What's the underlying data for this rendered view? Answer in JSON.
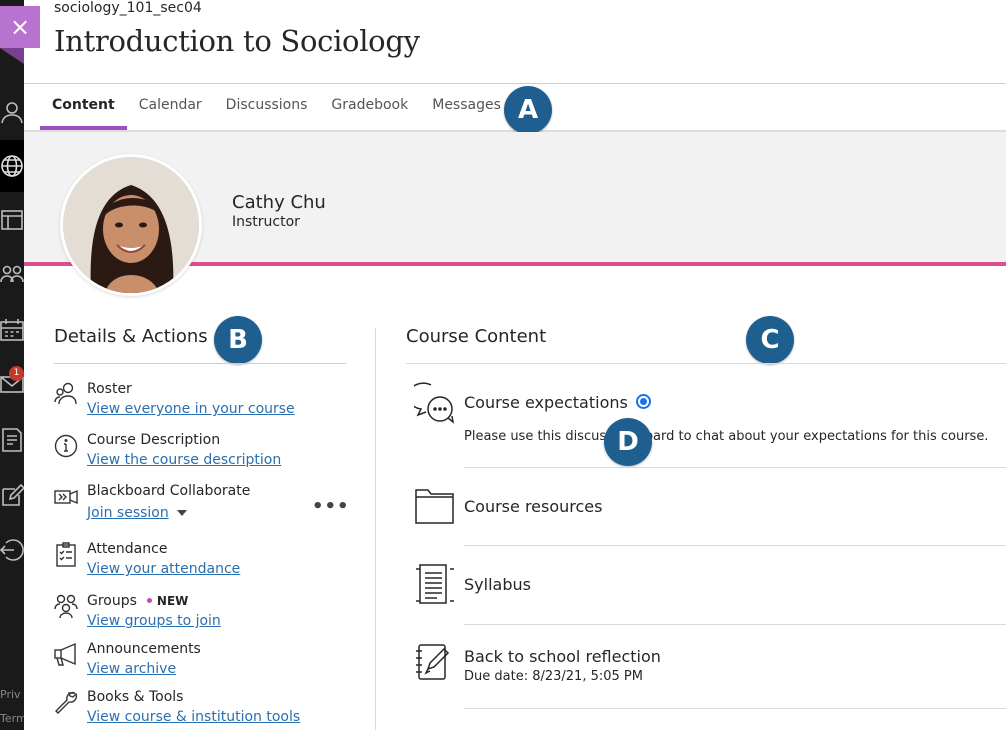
{
  "header": {
    "course_id": "sociology_101_sec04",
    "course_title": "Introduction to Sociology",
    "close_label": "×"
  },
  "tabs": [
    {
      "label": "Content",
      "active": true
    },
    {
      "label": "Calendar"
    },
    {
      "label": "Discussions"
    },
    {
      "label": "Gradebook"
    },
    {
      "label": "Messages"
    }
  ],
  "callouts": [
    "A",
    "B",
    "C",
    "D"
  ],
  "rail": {
    "mail_badge": "1",
    "footer": [
      "Priv",
      "Term"
    ]
  },
  "instructor": {
    "name": "Cathy Chu",
    "role": "Instructor"
  },
  "details": {
    "title": "Details & Actions",
    "items": [
      {
        "icon": "roster-icon",
        "title": "Roster",
        "link": "View everyone in your course"
      },
      {
        "icon": "info-icon",
        "title": "Course Description",
        "link": "View the course description"
      },
      {
        "icon": "collaborate-icon",
        "title": "Blackboard Collaborate",
        "link": "Join session"
      },
      {
        "icon": "attendance-icon",
        "title": "Attendance",
        "link": "View your attendance"
      },
      {
        "icon": "groups-icon",
        "title": "Groups",
        "badge": "NEW",
        "link": "View groups to join"
      },
      {
        "icon": "megaphone-icon",
        "title": "Announcements",
        "link": "View archive"
      },
      {
        "icon": "wrench-icon",
        "title": "Books & Tools",
        "link": "View course & institution tools"
      }
    ],
    "more_label": "•••"
  },
  "course_content": {
    "title": "Course Content",
    "items": [
      {
        "icon": "discussion-icon",
        "title": "Course expectations",
        "subtitle": "Please use this discussion board to chat about your expectations for this course."
      },
      {
        "icon": "folder-icon",
        "title": "Course resources"
      },
      {
        "icon": "document-icon",
        "title": "Syllabus"
      },
      {
        "icon": "journal-icon",
        "title": "Back to school reflection",
        "subtitle": "Due date: 8/23/21, 5:05 PM"
      }
    ]
  },
  "colors": {
    "accent_purple": "#9b4fc7",
    "banner_stripe": "#dc4f8f",
    "link": "#2a6fb0",
    "callout": "#1f5f8f"
  }
}
